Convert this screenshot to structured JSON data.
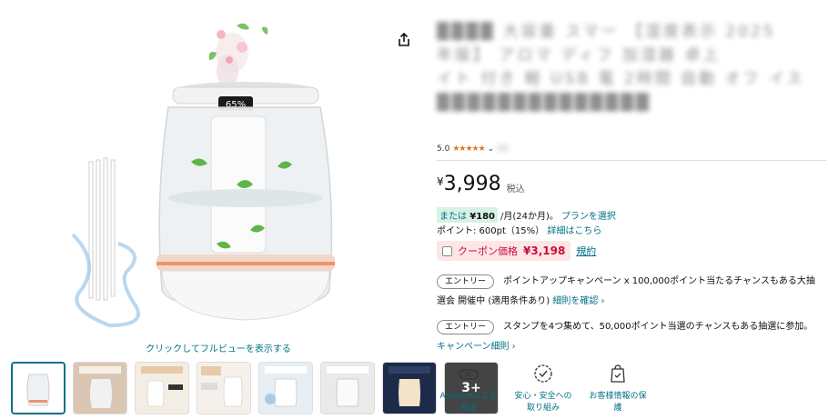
{
  "product": {
    "title_lines": [
      "████ 大容量 スマー 【湿度表示 2025",
      "年版】 アロマ ディフ 加湿器 卓上",
      "イト 付き 軽 USB 電 2時間 自動 オフ イス",
      "██████████████"
    ],
    "rating_value": "5.0",
    "rating_stars": "★★★★★",
    "rating_count": "(5)",
    "display_humidity": "65%"
  },
  "price": {
    "currency": "¥",
    "amount": "3,998",
    "tax_label": "税込"
  },
  "installment": {
    "prefix": "または",
    "amount": "¥180",
    "suffix": "/月(24か月)。",
    "link": "プランを選択"
  },
  "points": {
    "text": "ポイント: 600pt（15%）",
    "link": "詳細はこちら"
  },
  "coupon": {
    "label": "クーポン価格",
    "price": "¥3,198",
    "terms_link": "規約"
  },
  "promos": [
    {
      "button": "エントリー",
      "text": "ポイントアップキャンペーン x 100,000ポイント当たるチャンスもある大抽",
      "text2": "選会 開催中 (適用条件あり)",
      "link": "細則を確認 ›"
    },
    {
      "button": "エントリー",
      "text": "スタンプを4つ集めて、50,000ポイント当選のチャンスもある抽選に参加。",
      "link": "キャンペーン細則 ›"
    }
  ],
  "image_caption": "クリックしてフルビューを表示する",
  "thumbnails_more": "3+",
  "features": [
    {
      "icon": "truck-icon",
      "label": "Amazonによる発送"
    },
    {
      "icon": "shield-check-icon",
      "label": "安心・安全への取り組み"
    },
    {
      "icon": "lock-bag-icon",
      "label": "お客様情報の保護"
    }
  ],
  "colors": {
    "link": "#007185",
    "star": "#de7921",
    "coupon_red": "#cc0c39",
    "installment_bg": "#d7f1e4",
    "accent_orange": "#e8956b"
  }
}
